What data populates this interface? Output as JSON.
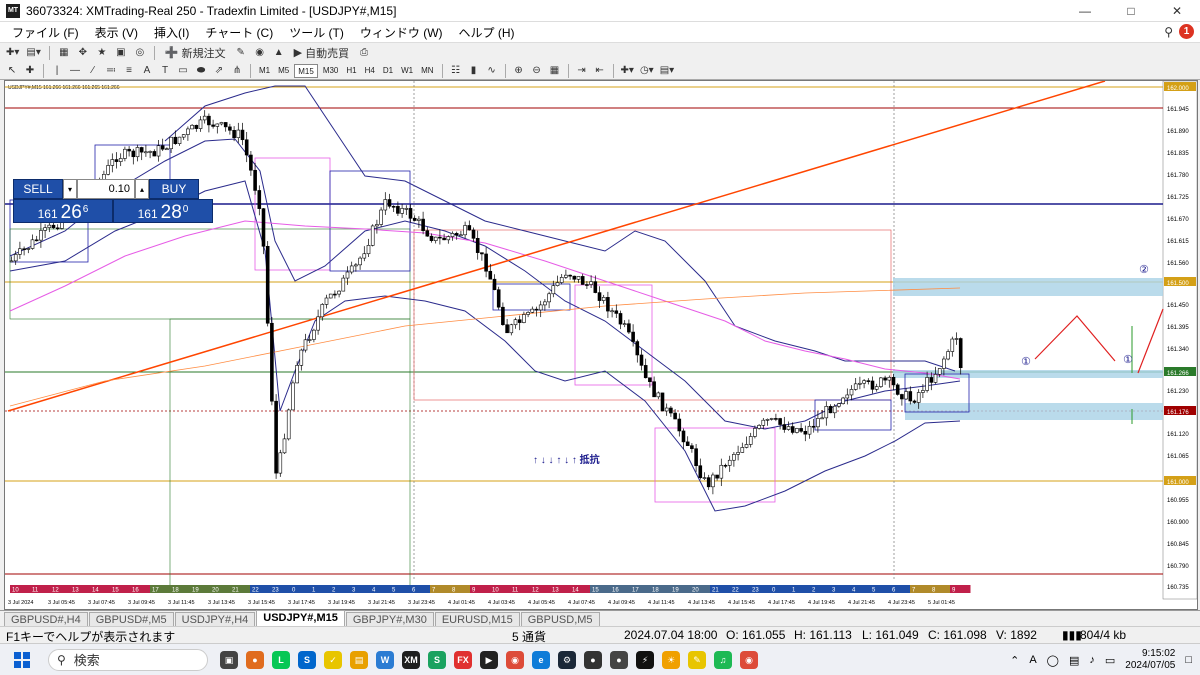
{
  "window": {
    "title": "36073324: XMTrading-Real 250 - Tradexfin Limited - [USDJPY#,M15]",
    "app_icon": "MT"
  },
  "menu": [
    "ファイル (F)",
    "表示 (V)",
    "挿入(I)",
    "チャート (C)",
    "ツール (T)",
    "ウィンドウ (W)",
    "ヘルプ (H)"
  ],
  "toolbar": {
    "new_order": "新規注文",
    "auto_trading": "自動売買",
    "timeframes": [
      "M1",
      "M5",
      "M15",
      "M30",
      "H1",
      "H4",
      "D1",
      "W1",
      "MN"
    ],
    "active_timeframe": "M15",
    "alert_badge": "1"
  },
  "trade_panel": {
    "sell_label": "SELL",
    "buy_label": "BUY",
    "lot": "0.10",
    "sell_price_big": "161",
    "sell_price_mid": "26",
    "sell_price_sup": "6",
    "buy_price_big": "161",
    "buy_price_mid": "28",
    "buy_price_sup": "0"
  },
  "chart": {
    "header_text": "USDJPY#,M15  161.266 161.266 161.265 161.266",
    "annotation_text": "↑ ↓ ↓ ↑ ↓ ↑   抵抗",
    "marker_1": "①",
    "marker_2": "②",
    "price_axis": [
      "162.000",
      "161.945",
      "161.890",
      "161.835",
      "161.780",
      "161.725",
      "161.670",
      "161.615",
      "161.560",
      "161.505",
      "161.450",
      "161.395",
      "161.340",
      "161.285",
      "161.266",
      "161.230",
      "161.176",
      "161.120",
      "161.065",
      "161.010",
      "160.955",
      "160.900",
      "160.845",
      "160.790",
      "160.735",
      "161.500",
      "161.000"
    ],
    "time_axis": [
      "3 Jul 2024",
      "3 Jul 05:45",
      "3 Jul 07:45",
      "3 Jul 09:45",
      "3 Jul 11:45",
      "3 Jul 13:45",
      "3 Jul 15:45",
      "3 Jul 17:45",
      "3 Jul 19:45",
      "3 Jul 21:45",
      "3 Jul 23:45",
      "4 Jul 01:45",
      "4 Jul 03:45",
      "4 Jul 05:45",
      "4 Jul 07:45",
      "4 Jul 09:45",
      "4 Jul 11:45",
      "4 Jul 13:45",
      "4 Jul 15:45",
      "4 Jul 17:45",
      "4 Jul 19:45",
      "4 Jul 21:45",
      "4 Jul 23:45",
      "5 Jul 01:45"
    ],
    "hour_labels": [
      "10",
      "11",
      "12",
      "13",
      "14",
      "15",
      "16",
      "17",
      "18",
      "19",
      "20",
      "21",
      "22",
      "23",
      "0",
      "1",
      "2",
      "3",
      "4",
      "5",
      "6",
      "7",
      "8",
      "9",
      "10",
      "11",
      "12",
      "13",
      "14",
      "15",
      "16",
      "17",
      "18",
      "19",
      "20",
      "21",
      "22",
      "23",
      "0",
      "1",
      "2",
      "3",
      "4",
      "5",
      "6",
      "7",
      "8",
      "9"
    ]
  },
  "tabs": [
    "GBPUSD#,H4",
    "GBPUSD#,M5",
    "USDJPY#,H4",
    "USDJPY#,M15",
    "GBPJPY#,M30",
    "EURUSD,M15",
    "GBPUSD,M5"
  ],
  "active_tab": "USDJPY#,M15",
  "status": {
    "help": "F1キーでヘルプが表示されます",
    "profile": "5 通貨",
    "datetime": "2024.07.04 18:00",
    "open": "O: 161.055",
    "high": "H: 161.113",
    "low": "L: 161.049",
    "close": "C: 161.098",
    "volume": "V: 1892",
    "traffic": "804/4 kb"
  },
  "taskbar": {
    "search_placeholder": "検索",
    "time": "9:15:02",
    "date": "2024/07/05",
    "tray_lang": "A"
  },
  "colors": {
    "sell_buy_bg": "#1f4fa8",
    "trend_line": "#ff4500",
    "ma_pink": "#e65ce6",
    "bollinger": "#2b2b8c",
    "level_navy": "#1a1a8c",
    "level_gold": "#d4a017",
    "level_red": "#a00000",
    "zone_blue": "#a9d2e6"
  }
}
